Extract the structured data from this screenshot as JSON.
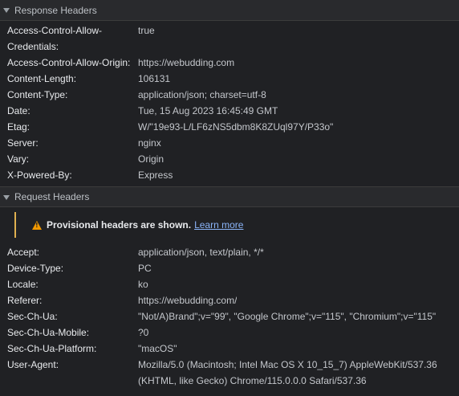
{
  "response_headers": {
    "title": "Response Headers",
    "rows": [
      {
        "name": "Access-Control-Allow-Credentials:",
        "value": "true"
      },
      {
        "name": "Access-Control-Allow-Origin:",
        "value": "https://webudding.com"
      },
      {
        "name": "Content-Length:",
        "value": "106131"
      },
      {
        "name": "Content-Type:",
        "value": "application/json; charset=utf-8"
      },
      {
        "name": "Date:",
        "value": "Tue, 15 Aug 2023 16:45:49 GMT"
      },
      {
        "name": "Etag:",
        "value": "W/\"19e93-L/LF6zNS5dbm8K8ZUql97Y/P33o\""
      },
      {
        "name": "Server:",
        "value": "nginx"
      },
      {
        "name": "Vary:",
        "value": "Origin"
      },
      {
        "name": "X-Powered-By:",
        "value": "Express"
      }
    ]
  },
  "request_headers": {
    "title": "Request Headers",
    "notice": {
      "text": "Provisional headers are shown.",
      "link": "Learn more"
    },
    "rows": [
      {
        "name": "Accept:",
        "value": "application/json, text/plain, */*"
      },
      {
        "name": "Device-Type:",
        "value": "PC"
      },
      {
        "name": "Locale:",
        "value": "ko"
      },
      {
        "name": "Referer:",
        "value": "https://webudding.com/"
      },
      {
        "name": "Sec-Ch-Ua:",
        "value": "\"Not/A)Brand\";v=\"99\", \"Google Chrome\";v=\"115\", \"Chromium\";v=\"115\""
      },
      {
        "name": "Sec-Ch-Ua-Mobile:",
        "value": "?0"
      },
      {
        "name": "Sec-Ch-Ua-Platform:",
        "value": "\"macOS\""
      },
      {
        "name": "User-Agent:",
        "value": "Mozilla/5.0 (Macintosh; Intel Mac OS X 10_15_7) AppleWebKit/537.36 (KHTML, like Gecko) Chrome/115.0.0.0 Safari/537.36"
      }
    ]
  },
  "icons": {
    "section_toggle": "triangle-down-icon",
    "notice": "warning-icon"
  },
  "colors": {
    "background": "#202124",
    "header_background": "#292a2d",
    "warning": "#f29900",
    "link": "#8ab4f8"
  }
}
